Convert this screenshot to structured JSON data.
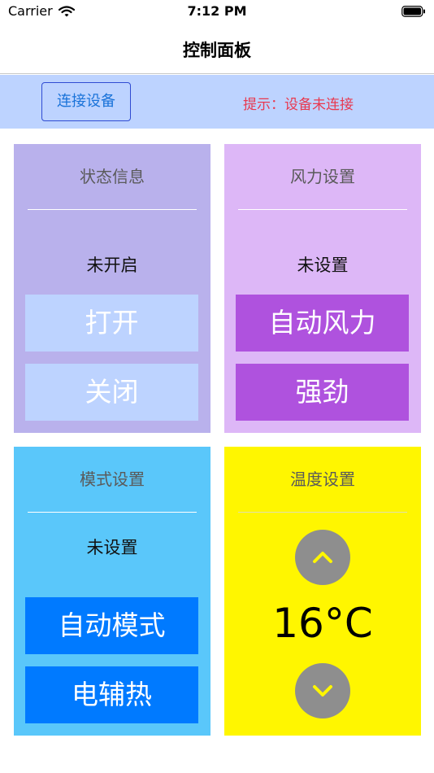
{
  "status_bar": {
    "carrier": "Carrier",
    "time": "7:12 PM"
  },
  "nav": {
    "title": "控制面板"
  },
  "connection": {
    "button_label": "连接设备",
    "hint": "提示：设备未连接"
  },
  "panels": {
    "status": {
      "title": "状态信息",
      "value": "未开启",
      "buttons": [
        "打开",
        "关闭"
      ]
    },
    "wind": {
      "title": "风力设置",
      "value": "未设置",
      "buttons": [
        "自动风力",
        "强劲"
      ]
    },
    "mode": {
      "title": "模式设置",
      "value": "未设置",
      "buttons": [
        "自动模式",
        "电辅热"
      ]
    },
    "temperature": {
      "title": "温度设置",
      "value": "16°C"
    }
  },
  "icons": {
    "wifi": "wifi-icon",
    "battery": "battery-icon",
    "up": "chevron-up-icon",
    "down": "chevron-down-icon"
  },
  "colors": {
    "status_panel": "#b9b1ec",
    "wind_panel": "#ddb7f7",
    "mode_panel": "#5ac7fa",
    "temp_panel": "#fff600",
    "connect_bar": "#bdd3ff",
    "hint_text": "#e8394f",
    "purple_button": "#af52de",
    "blue_button": "#007aff",
    "round_button": "#8e8e8e",
    "chevron": "#fff600"
  }
}
